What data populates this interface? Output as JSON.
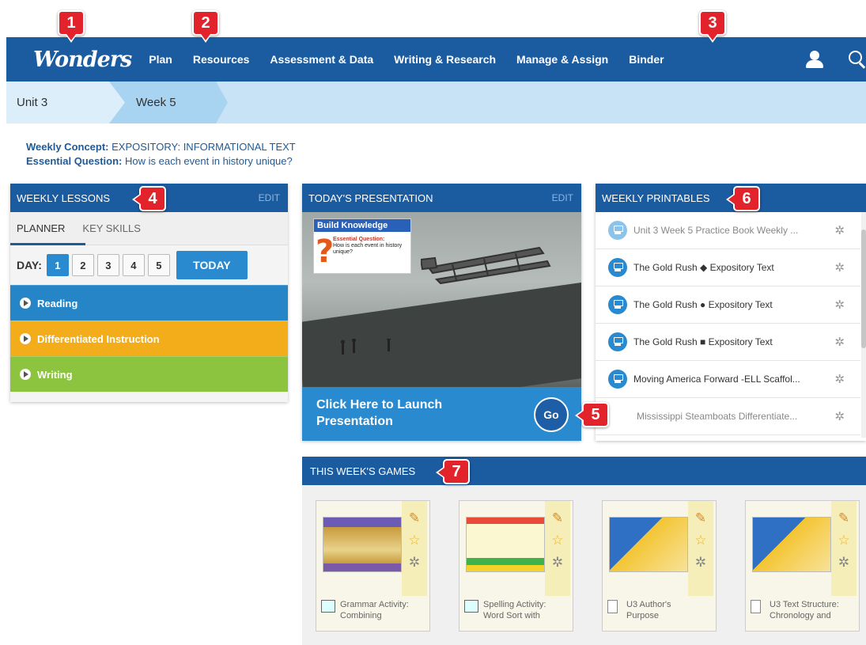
{
  "nav": {
    "logo": "Wonders",
    "links": [
      "Plan",
      "Resources",
      "Assessment & Data",
      "Writing & Research",
      "Manage & Assign",
      "Binder"
    ],
    "icons": [
      "user-icon",
      "search-icon"
    ]
  },
  "breadcrumb": {
    "unit": "Unit 3",
    "week": "Week 5"
  },
  "concept": {
    "label1": "Weekly Concept:",
    "value1": "EXPOSITORY: INFORMATIONAL TEXT",
    "label2": "Essential Question:",
    "value2": "How is each event in history unique?"
  },
  "lessons": {
    "title": "WEEKLY LESSONS",
    "edit": "EDIT",
    "tabs": [
      "PLANNER",
      "KEY SKILLS"
    ],
    "day_label": "DAY:",
    "days": [
      "1",
      "2",
      "3",
      "4",
      "5"
    ],
    "active_day": "1",
    "today": "TODAY",
    "rows": [
      {
        "label": "Reading",
        "color": "#2585c7"
      },
      {
        "label": "Differentiated Instruction",
        "color": "#f3ad1b"
      },
      {
        "label": "Writing",
        "color": "#8cc43f"
      }
    ]
  },
  "presentation": {
    "title": "TODAY'S PRESENTATION",
    "edit": "EDIT",
    "card_title": "Build Knowledge",
    "card_q_label": "Essential Question:",
    "card_q": "How is each event in history unique?",
    "launch": "Click Here to Launch Presentation",
    "go": "Go"
  },
  "printables": {
    "title": "WEEKLY PRINTABLES",
    "items": [
      "Unit 3 Week 5 Practice Book Weekly ...",
      "The Gold Rush ◆ Expository Text",
      "The Gold Rush ● Expository Text",
      "The Gold Rush ■ Expository Text",
      "Moving America Forward -ELL Scaffol...",
      "Mississippi Steamboats Differentiate..."
    ]
  },
  "games": {
    "title": "THIS WEEK'S GAMES",
    "items": [
      {
        "line1": "Grammar Activity:",
        "line2": "Combining"
      },
      {
        "line1": "Spelling Activity:",
        "line2": "Word Sort with"
      },
      {
        "line1": "U3 Author's",
        "line2": "Purpose"
      },
      {
        "line1": "U3 Text Structure:",
        "line2": "Chronology and"
      }
    ]
  },
  "callouts": [
    "1",
    "2",
    "3",
    "4",
    "5",
    "6",
    "7"
  ],
  "colors": {
    "nav": "#1b5ba0",
    "accent": "#2a8ad0",
    "callout": "#e3232c"
  }
}
